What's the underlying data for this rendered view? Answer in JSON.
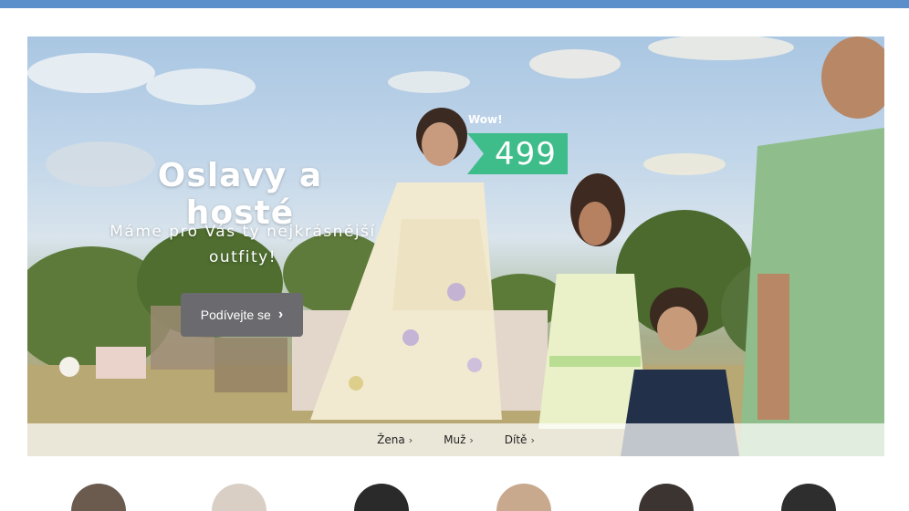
{
  "hero": {
    "title": "Oslavy a hosté",
    "subtitle": "Máme pro Vás ty nejkrásnější outfity!",
    "cta_label": "Podívejte se",
    "badge_wow": "Wow!",
    "badge_price": "499"
  },
  "categories": [
    {
      "label": "Žena"
    },
    {
      "label": "Muž"
    },
    {
      "label": "Dítě"
    }
  ],
  "colors": {
    "topbar": "#5b8fcb",
    "price_badge": "#3ebd8a",
    "cta_bg": "#6b6b6f"
  },
  "icons": {
    "cta_chevron": "chevron-right-icon",
    "category_chevron": "chevron-right-icon"
  }
}
